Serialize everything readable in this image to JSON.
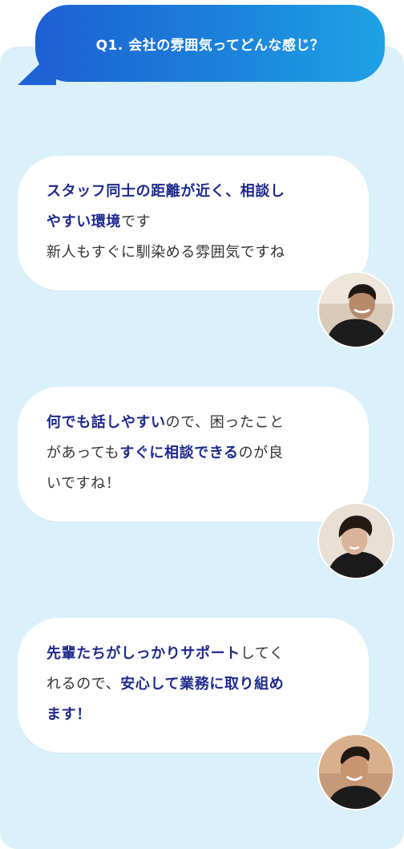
{
  "question": {
    "label": "Q1. 会社の雰囲気ってどんな感じ？"
  },
  "answers": [
    {
      "line1": [
        {
          "text": "スタッフ同士の距離が近く、相談し",
          "hl": true
        }
      ],
      "line2": [
        {
          "text": "やすい環境",
          "hl": true
        },
        {
          "text": "です",
          "hl": false
        }
      ],
      "line3": [
        {
          "text": "新人もすぐに馴染める雰囲気ですね",
          "hl": false
        }
      ]
    },
    {
      "line1": [
        {
          "text": "何でも話しやすい",
          "hl": true
        },
        {
          "text": "ので、困ったこと",
          "hl": false
        }
      ],
      "line2": [
        {
          "text": "があってもすぐに相談できる",
          "hl": true
        },
        {
          "text": "のが良",
          "hl": false
        }
      ],
      "line3": [
        {
          "text": "いですね！",
          "hl": false
        }
      ]
    },
    {
      "line1": [
        {
          "text": "先輩たちがしっかりサポート",
          "hl": true
        },
        {
          "text": "してく",
          "hl": false
        }
      ],
      "line2": [
        {
          "text": "れるので、",
          "hl": false
        },
        {
          "text": "安心して業務に取り組め",
          "hl": true
        }
      ],
      "line3": [
        {
          "text": "ます！",
          "hl": true
        }
      ]
    }
  ]
}
